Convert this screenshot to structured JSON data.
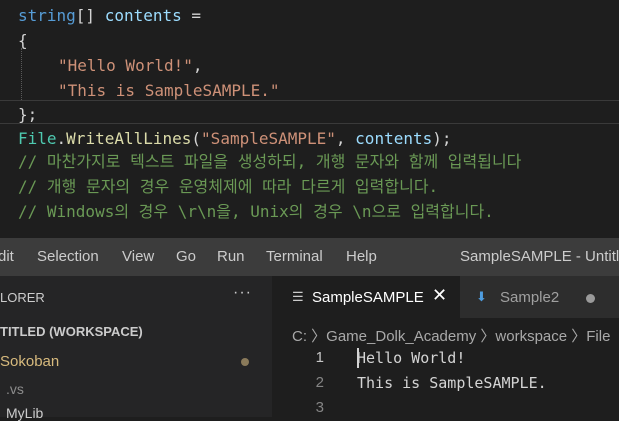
{
  "code": {
    "l1_kw": "string",
    "l1_br": "[] ",
    "l1_var": "contents",
    "l1_eq": " =",
    "l2": "{",
    "l3_str": "\"Hello World!\"",
    "l3_comma": ",",
    "l4_str": "\"This is SampleSAMPLE.\"",
    "l5": "};",
    "l6_cls": "File",
    "l6_dot": ".",
    "l6_fn": "WriteAllLines",
    "l6_open": "(",
    "l6_str": "\"SampleSAMPLE\"",
    "l6_sep": ", ",
    "l6_arg": "contents",
    "l6_close": ");",
    "comment1": "// 마찬가지로 텍스트 파일을 생성하되, 개행 문자와 함께 입력됩니다",
    "comment2": "// 개행 문자의 경우 운영체제에 따라 다르게 입력합니다.",
    "comment3": "// Windows의 경우 \\r\\n을, Unix의 경우 \\n으로 입력합니다."
  },
  "menubar": {
    "items": [
      "dit",
      "Selection",
      "View",
      "Go",
      "Run",
      "Terminal",
      "Help"
    ],
    "window_title": "SampleSAMPLE - Untitle"
  },
  "sidebar": {
    "title": "LORER",
    "more": "···",
    "workspace": "TITLED (WORKSPACE)",
    "items": [
      "Sokoban",
      ".vs",
      "MyLib"
    ]
  },
  "tabs": [
    {
      "label": "SampleSAMPLE",
      "close": "✕",
      "icon": "☰"
    },
    {
      "label": "Sample2",
      "icon": "⬇"
    }
  ],
  "breadcrumb": "C: 〉Game_Dolk_Academy 〉workspace 〉File",
  "editor": {
    "line_numbers": [
      "1",
      "2",
      "3"
    ],
    "lines": [
      "Hello World!",
      "This is SampleSAMPLE.",
      ""
    ]
  }
}
